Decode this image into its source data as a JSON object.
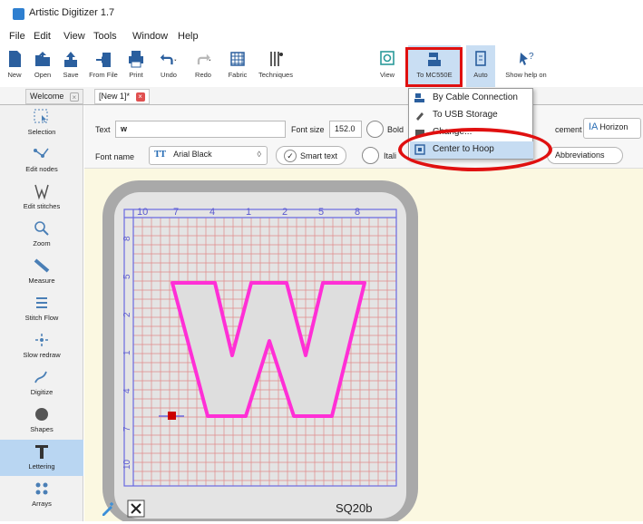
{
  "window": {
    "title": "Artistic Digitizer 1.7"
  },
  "menu": [
    "File",
    "Edit",
    "View",
    "Tools",
    "Window",
    "Help"
  ],
  "toolbar": {
    "new": "New",
    "open": "Open",
    "save": "Save",
    "from_file": "From File",
    "print": "Print",
    "undo": "Undo",
    "redo": "Redo",
    "fabric": "Fabric",
    "techniques": "Techniques",
    "view": "View",
    "to_machine": "To MC550E",
    "auto": "Auto",
    "show_help": "Show help on"
  },
  "tabs": {
    "welcome": "Welcome",
    "doc": "[New 1]*"
  },
  "properties": {
    "text_label": "Text",
    "text_value": "w",
    "font_size_label": "Font size",
    "font_size_value": "152.0",
    "bold_label": "Bold",
    "italic_label": "Itali",
    "font_name_label": "Font name",
    "font_name_value": "Arial Black",
    "smart_text_label": "Smart text",
    "placement_label": "cement",
    "placement_value": "Horizon",
    "abbreviations_label": "Abbreviations"
  },
  "dropdown": {
    "items": [
      "By Cable Connection",
      "To USB Storage",
      "Change...",
      "Center to Hoop"
    ],
    "highlighted": "Center to Hoop"
  },
  "sidebar": [
    "Selection",
    "Edit nodes",
    "Edit stitches",
    "Zoom",
    "Measure",
    "Stitch Flow",
    "Slow redraw",
    "Digitize",
    "Shapes",
    "Lettering",
    "Arrays"
  ],
  "canvas": {
    "top_ruler": [
      "10",
      "7",
      "4",
      "1",
      "2",
      "5",
      "8"
    ],
    "side_ruler": [
      "8",
      "5",
      "2",
      "1",
      "4",
      "7",
      "10"
    ],
    "glyph": "W",
    "hoop_label": "SQ20b"
  },
  "colors": {
    "accent": "#c9def3",
    "highlight_red": "#e01010",
    "stitch_pink": "#ff2fd6",
    "grid": "#e08a8a",
    "canvas_bg": "#fbf8e1"
  }
}
